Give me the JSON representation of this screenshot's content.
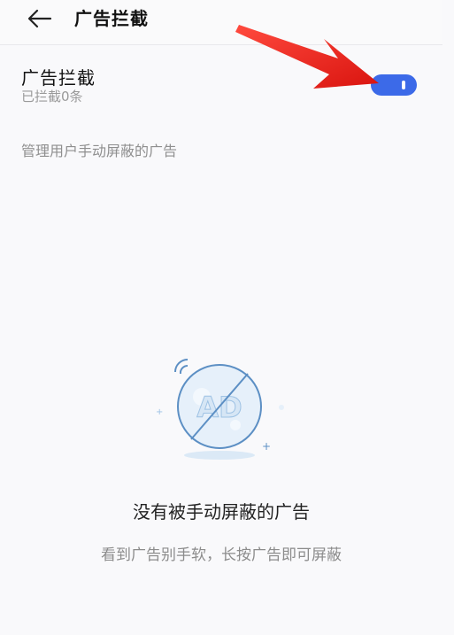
{
  "header": {
    "back_icon": "arrow-left-icon",
    "title": "广告拦截"
  },
  "setting": {
    "title": "广告拦截",
    "subtitle": "已拦截0条",
    "toggle_on": true,
    "toggle_color": "#3c6ae8"
  },
  "annotation": {
    "icon": "red-arrow-pointer-icon",
    "color": "#e8231e"
  },
  "manage": {
    "label": "管理用户手动屏蔽的广告"
  },
  "empty_state": {
    "illustration_icon": "no-ad-icon",
    "illustration_text": "AD",
    "title": "没有被手动屏蔽的广告",
    "hint": "看到广告别手软，长按广告即可屏蔽"
  }
}
